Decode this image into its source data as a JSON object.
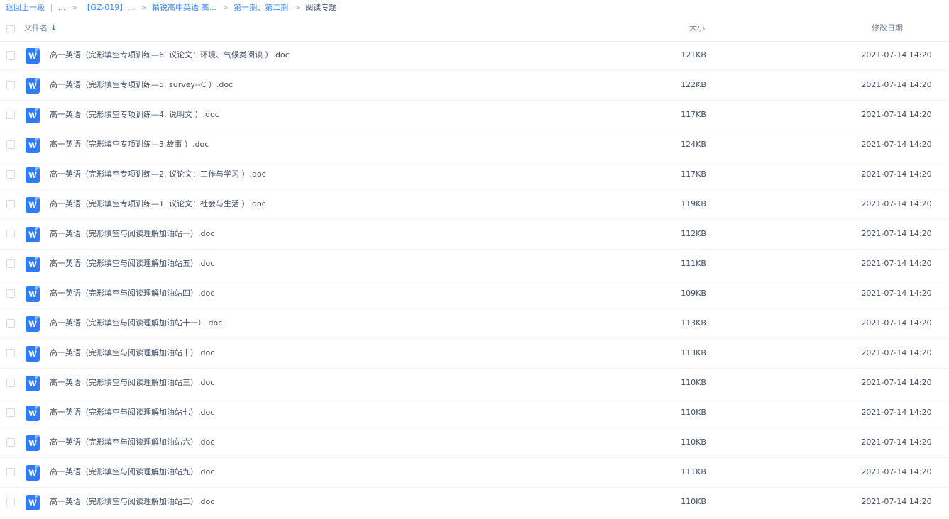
{
  "breadcrumb": {
    "back": "返回上一级",
    "divider": "|",
    "ellipsis": "...",
    "items": [
      "【GZ-019】...",
      "精锐高中英语 高...",
      "第一期、第二期"
    ],
    "current": "阅读专题",
    "separator": ">"
  },
  "header": {
    "name": "文件名",
    "sort_icon": "arrow-down-icon",
    "size": "大小",
    "date": "修改日期"
  },
  "accent_color": "#2f7cf6",
  "file_icon": {
    "name": "word-doc-icon",
    "letter": "W"
  },
  "files": [
    {
      "name": "高一英语（完形填空专项训练—6. 议论文：环境、气候类阅读 ）.doc",
      "size": "121KB",
      "date": "2021-07-14 14:20"
    },
    {
      "name": "高一英语（完形填空专项训练—5. survey--C ）.doc",
      "size": "122KB",
      "date": "2021-07-14 14:20"
    },
    {
      "name": "高一英语（完形填空专项训练—4. 说明文 ）.doc",
      "size": "117KB",
      "date": "2021-07-14 14:20"
    },
    {
      "name": "高一英语（完形填空专项训练—3.故事 ）.doc",
      "size": "124KB",
      "date": "2021-07-14 14:20"
    },
    {
      "name": "高一英语（完形填空专项训练—2. 议论文：工作与学习 ）.doc",
      "size": "117KB",
      "date": "2021-07-14 14:20"
    },
    {
      "name": "高一英语（完形填空专项训练—1. 议论文：社会与生活 ）.doc",
      "size": "119KB",
      "date": "2021-07-14 14:20"
    },
    {
      "name": "高一英语（完形填空与阅读理解加油站一）.doc",
      "size": "112KB",
      "date": "2021-07-14 14:20"
    },
    {
      "name": "高一英语（完形填空与阅读理解加油站五）.doc",
      "size": "111KB",
      "date": "2021-07-14 14:20"
    },
    {
      "name": "高一英语（完形填空与阅读理解加油站四）.doc",
      "size": "109KB",
      "date": "2021-07-14 14:20"
    },
    {
      "name": "高一英语（完形填空与阅读理解加油站十一）.doc",
      "size": "113KB",
      "date": "2021-07-14 14:20"
    },
    {
      "name": "高一英语（完形填空与阅读理解加油站十）.doc",
      "size": "113KB",
      "date": "2021-07-14 14:20"
    },
    {
      "name": "高一英语（完形填空与阅读理解加油站三）.doc",
      "size": "110KB",
      "date": "2021-07-14 14:20"
    },
    {
      "name": "高一英语（完形填空与阅读理解加油站七）.doc",
      "size": "110KB",
      "date": "2021-07-14 14:20"
    },
    {
      "name": "高一英语（完形填空与阅读理解加油站六）.doc",
      "size": "110KB",
      "date": "2021-07-14 14:20"
    },
    {
      "name": "高一英语（完形填空与阅读理解加油站九）.doc",
      "size": "111KB",
      "date": "2021-07-14 14:20"
    },
    {
      "name": "高一英语（完形填空与阅读理解加油站二）.doc",
      "size": "110KB",
      "date": "2021-07-14 14:20"
    }
  ]
}
